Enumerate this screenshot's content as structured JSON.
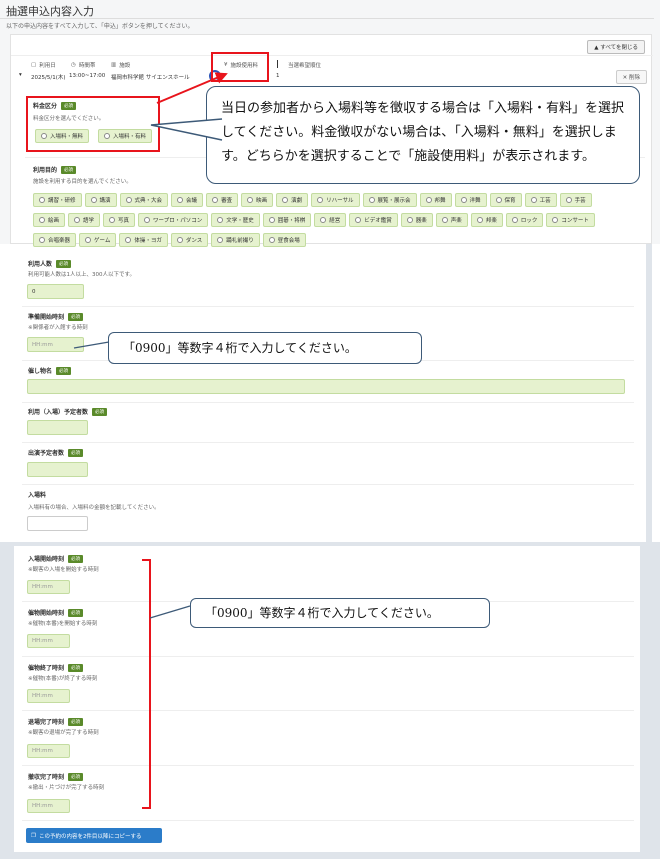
{
  "page": {
    "title": "抽選申込内容入力",
    "subtitle": "以下の申込内容をすべて入力して、「申込」ボタンを押してください。",
    "collapse_all": "すべてを閉じる"
  },
  "booking": {
    "headers": {
      "date": "利用日",
      "time": "時間帯",
      "facility": "施設",
      "fee": "施設使用料",
      "rank": "当選希望順位"
    },
    "date_value": "2025/5/1(木)",
    "time_value": "13:00~17:00",
    "facility_value": "福岡市科学館 サイエンスホール",
    "rank_value": "1",
    "delete_label": "削除"
  },
  "fee_section": {
    "label": "料金区分",
    "required": "必須",
    "hint": "料金区分を選んでください。",
    "options": [
      "入場料・無料",
      "入場料・有料"
    ]
  },
  "callout_fee": {
    "text": "当日の参加者から入場料等を徴収する場合は「入場料・有料」を選択してください。料金徴収がない場合は、「入場料・無料」を選択します。どちらかを選択することで「施設使用料」が表示されます。"
  },
  "purpose_section": {
    "label": "利用目的",
    "required": "必須",
    "hint": "施設を利用する目的を選んでください。",
    "row1": [
      "講習・研修",
      "講演",
      "式典・大会",
      "会議",
      "審査",
      "映画",
      "演劇",
      "リハーサル",
      "展覧・展示会",
      "邦舞",
      "洋舞",
      "保育",
      "工芸",
      "手芸"
    ],
    "row2": [
      "絵画",
      "語学",
      "写真",
      "ワープロ・パソコン",
      "文学・歴史",
      "囲碁・将棋",
      "経営",
      "ビデオ鑑賞",
      "器楽",
      "声楽",
      "邦楽",
      "ロック",
      "コンサート"
    ],
    "row3": [
      "合唱楽器",
      "ゲーム",
      "体操・ヨガ",
      "ダンス",
      "踊礼前撮り",
      "昼食会場"
    ]
  },
  "panel2": {
    "users": {
      "label": "利用人数",
      "required": "必須",
      "hint": "利用可能人数は1人以上、300人以下です。",
      "value": "0"
    },
    "prep_start": {
      "label": "準備開始時刻",
      "required": "必須",
      "hint": "※関係者が入館する時刻",
      "placeholder": "HH:mm"
    },
    "event_name": {
      "label": "催し物名",
      "required": "必須"
    },
    "expected_visitors": {
      "label": "利用（入場）予定者数",
      "required": "必須"
    },
    "performers": {
      "label": "出演予定者数",
      "required": "必須"
    },
    "entry_fee": {
      "label": "入場料",
      "hint": "入場料有の場合、入場料の金額を記載してください。"
    }
  },
  "callout_time1": {
    "text": "「0900」等数字４桁で入力してください。"
  },
  "panel3": {
    "fields": [
      {
        "label": "入場開始時刻",
        "required": "必須",
        "hint": "※観客の入場を開始する時刻",
        "placeholder": "HH:mm"
      },
      {
        "label": "催物開始時刻",
        "required": "必須",
        "hint": "※催物(本番)を開始する時刻",
        "placeholder": "HH:mm"
      },
      {
        "label": "催物終了時刻",
        "required": "必須",
        "hint": "※催物(本番)が終了する時刻",
        "placeholder": "HH:mm"
      },
      {
        "label": "退場完了時刻",
        "required": "必須",
        "hint": "※観客の退場が完了する時刻",
        "placeholder": "HH:mm"
      },
      {
        "label": "撤収完了時刻",
        "required": "必須",
        "hint": "※撤出・片づけが完了する時刻",
        "placeholder": "HH:mm"
      }
    ],
    "copy_button": "この予約の内容を2件目以降にコピーする"
  },
  "callout_time2": {
    "text": "「0900」等数字４桁で入力してください。"
  },
  "colors": {
    "accent_red": "#e8141c",
    "callout_border": "#3d5a78",
    "chip_bg": "#e6f2cf",
    "required_badge": "#5a8a2a",
    "copy_button": "#2b7cc9"
  }
}
